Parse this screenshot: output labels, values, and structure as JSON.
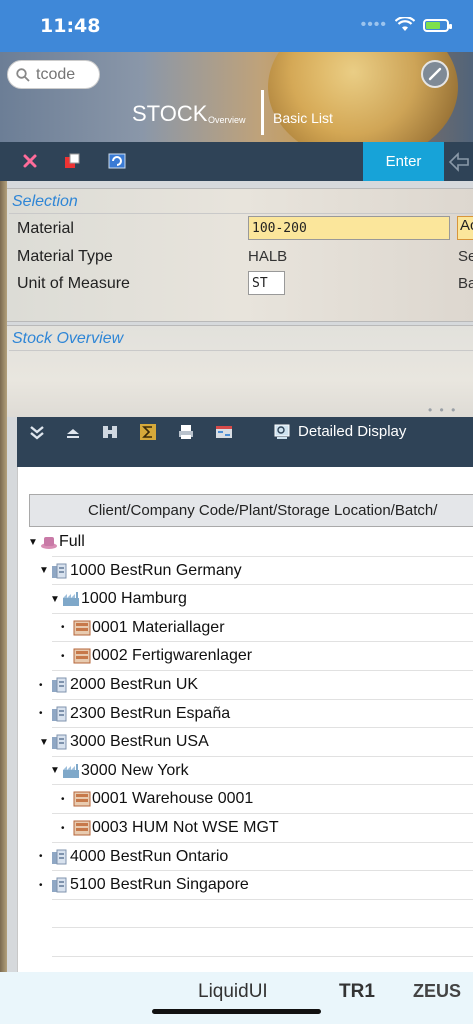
{
  "status": {
    "time": "11:48",
    "icons": [
      "cellular-dots",
      "wifi-icon",
      "battery-charging-icon"
    ]
  },
  "header": {
    "search_placeholder": "tcode",
    "title": "STOCK",
    "title_sub": "Overview",
    "tab_basic_list": "Basic List"
  },
  "toolbar": {
    "enter_label": "Enter",
    "icons": [
      "cancel-icon",
      "new-session-icon",
      "refresh-icon",
      "back-icon"
    ]
  },
  "selection": {
    "title": "Selection",
    "material_label": "Material",
    "material_value": "100-200",
    "material_type_label": "Material Type",
    "material_type_value": "HALB",
    "unit_label": "Unit of Measure",
    "unit_value": "ST",
    "cut_ac": "Ac",
    "cut_se": "Se",
    "cut_ba": "Ba"
  },
  "stock_overview": {
    "title": "Stock Overview",
    "detailed_display": "Detailed Display",
    "column_header": "Client/Company Code/Plant/Storage Location/Batch/"
  },
  "tree": [
    {
      "label": "Full",
      "toggle": "▼",
      "icon": "client-icon",
      "indent": 0
    },
    {
      "label": "1000 BestRun Germany",
      "toggle": "▼",
      "icon": "company-code-icon",
      "indent": 1
    },
    {
      "label": "1000 Hamburg",
      "toggle": "▼",
      "icon": "plant-icon",
      "indent": 2
    },
    {
      "label": "0001 Materiallager",
      "toggle": "•",
      "icon": "storage-location-icon",
      "indent": 3
    },
    {
      "label": "0002 Fertigwarenlager",
      "toggle": "•",
      "icon": "storage-location-icon",
      "indent": 3
    },
    {
      "label": "2000 BestRun UK",
      "toggle": "•",
      "icon": "company-code-icon",
      "indent": 1
    },
    {
      "label": "2300 BestRun España",
      "toggle": "•",
      "icon": "company-code-icon",
      "indent": 1
    },
    {
      "label": "3000 BestRun USA",
      "toggle": "▼",
      "icon": "company-code-icon",
      "indent": 1
    },
    {
      "label": "3000 New York",
      "toggle": "▼",
      "icon": "plant-icon",
      "indent": 2
    },
    {
      "label": "0001 Warehouse 0001",
      "toggle": "•",
      "icon": "storage-location-icon",
      "indent": 3
    },
    {
      "label": "0003 HUM Not WSE MGT",
      "toggle": "•",
      "icon": "storage-location-icon",
      "indent": 3
    },
    {
      "label": "4000 BestRun Ontario",
      "toggle": "•",
      "icon": "company-code-icon",
      "indent": 1
    },
    {
      "label": "5100 BestRun Singapore",
      "toggle": "•",
      "icon": "company-code-icon",
      "indent": 1
    }
  ],
  "bottom": {
    "app": "LiquidUI",
    "system": "TR1",
    "server": "ZEUS"
  },
  "colors": {
    "status_bar": "#3f88d8",
    "toolbar": "#2f4357",
    "enter": "#17a3d8",
    "section_title": "#2f86d6",
    "input_yellow": "#fbe69b"
  }
}
